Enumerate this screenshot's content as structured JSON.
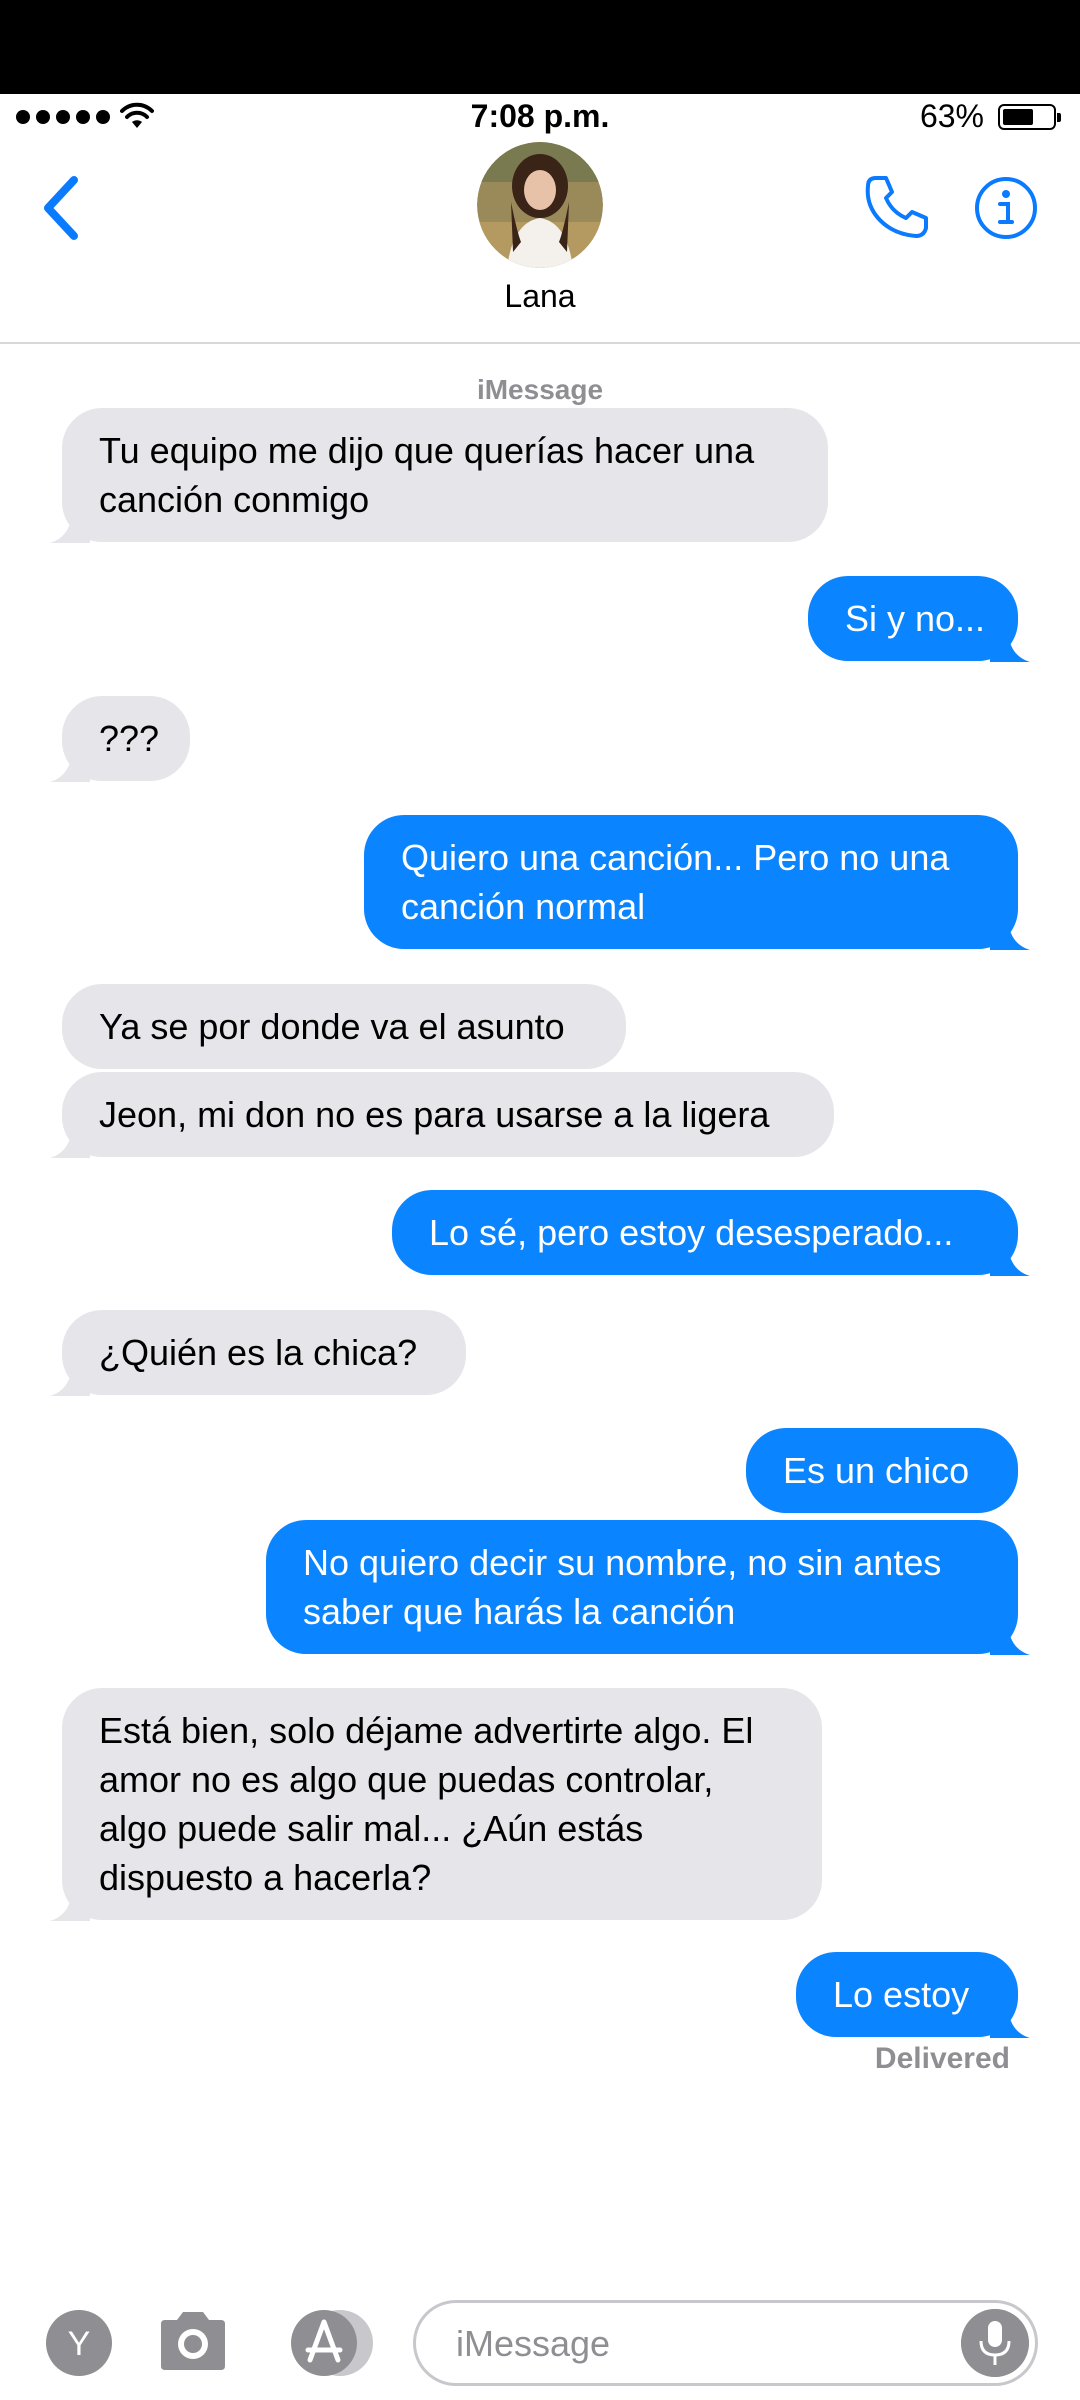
{
  "status_bar": {
    "time": "7:08 p.m.",
    "battery_percent": "63%",
    "battery_level": 0.63
  },
  "header": {
    "contact_name": "Lana",
    "icons": [
      "chevron-left-icon",
      "phone-icon",
      "info-icon"
    ]
  },
  "conversation": {
    "service_label": "iMessage",
    "messages": [
      {
        "side": "received",
        "lines": [
          "Tu equipo me dijo que querías hacer una",
          "canción conmigo"
        ]
      },
      {
        "side": "sent",
        "lines": [
          "Si y no..."
        ]
      },
      {
        "side": "received",
        "lines": [
          "???"
        ]
      },
      {
        "side": "sent",
        "lines": [
          "Quiero una canción... Pero no una",
          "canción normal"
        ]
      },
      {
        "side": "received",
        "lines": [
          "Ya se por donde va el asunto"
        ]
      },
      {
        "side": "received",
        "lines": [
          "Jeon, mi don no es para usarse a la ligera"
        ]
      },
      {
        "side": "sent",
        "lines": [
          "Lo sé, pero estoy desesperado..."
        ]
      },
      {
        "side": "received",
        "lines": [
          "¿Quién es la chica?"
        ]
      },
      {
        "side": "sent",
        "lines": [
          "Es un chico"
        ]
      },
      {
        "side": "sent",
        "lines": [
          "No quiero decir su nombre, no sin antes",
          "saber que harás la canción"
        ]
      },
      {
        "side": "received",
        "lines": [
          "Está bien, solo déjame advertirte algo. El",
          "amor no es algo que puedas controlar,",
          "algo puede salir mal... ¿Aún estás",
          "dispuesto a hacerla?"
        ]
      },
      {
        "side": "sent",
        "lines": [
          "Lo estoy"
        ]
      }
    ],
    "delivered_label": "Delivered"
  },
  "composer": {
    "app_button_letter": "Y",
    "placeholder": "iMessage",
    "icons": [
      "camera-icon",
      "app-store-icon",
      "microphone-icon"
    ]
  },
  "colors": {
    "sent_bubble": "#0a84ff",
    "received_bubble": "#e5e5ea",
    "accent": "#0a7aff"
  }
}
